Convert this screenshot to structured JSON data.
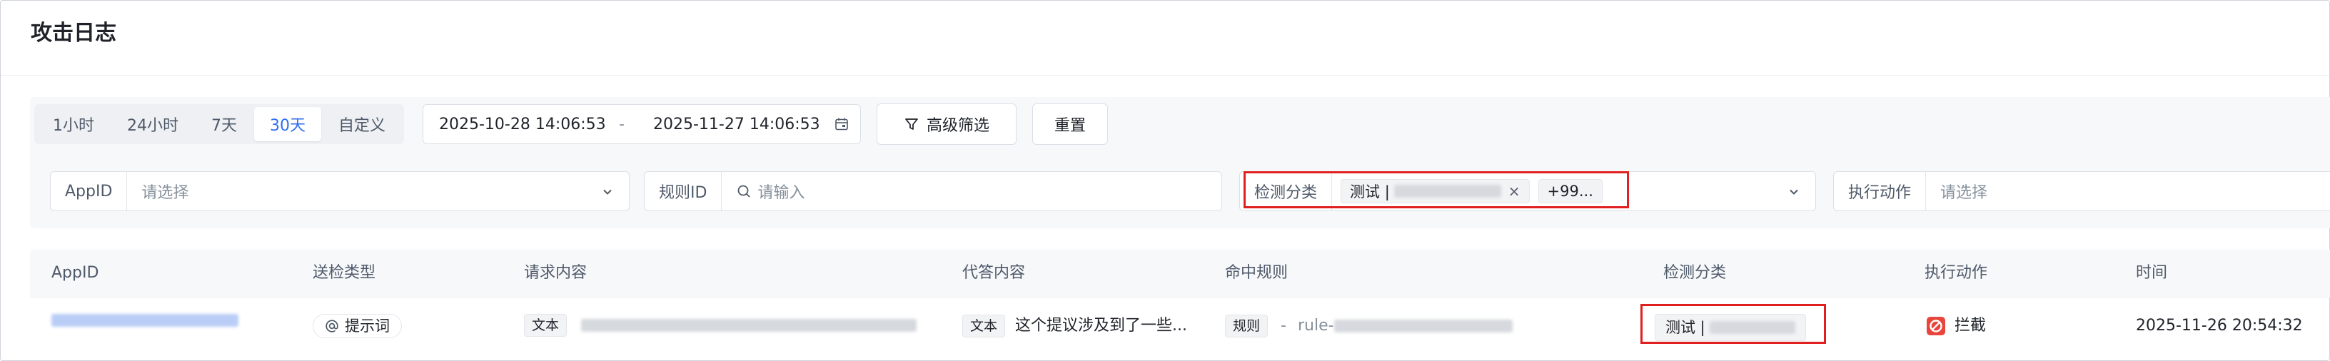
{
  "page": {
    "title": "攻击日志"
  },
  "time_range": {
    "options": [
      "1小时",
      "24小时",
      "7天",
      "30天",
      "自定义"
    ],
    "selected_index": 3,
    "start": "2025-10-28 14:06:53",
    "separator": "-",
    "end": "2025-11-27 14:06:53"
  },
  "toolbar": {
    "advanced_filter": "高级筛选",
    "reset": "重置"
  },
  "filters": {
    "appid": {
      "label": "AppID",
      "placeholder": "请选择"
    },
    "rule_id": {
      "label": "规则ID",
      "placeholder": "请输入"
    },
    "detect_category": {
      "label": "检测分类",
      "tag_text": "测试 |",
      "tag_close": "×",
      "more": "+99..."
    },
    "action": {
      "label": "执行动作",
      "placeholder": "请选择"
    }
  },
  "table": {
    "headers": [
      "AppID",
      "送检类型",
      "请求内容",
      "代答内容",
      "命中规则",
      "检测分类",
      "执行动作",
      "时间"
    ],
    "rows": [
      {
        "check_type": "提示词",
        "request_tag": "文本",
        "answer_tag": "文本",
        "answer_text": "这个提议涉及到了一些...",
        "rule_tag": "规则",
        "rule_dash": "-",
        "rule_prefix": "rule-",
        "category_text": "测试 |",
        "action": "拦截",
        "time": "2025-11-26 20:54:32"
      }
    ]
  },
  "colors": {
    "accent": "#2f6fed",
    "highlight_border": "#e02020",
    "block_icon": "#e8453c"
  }
}
